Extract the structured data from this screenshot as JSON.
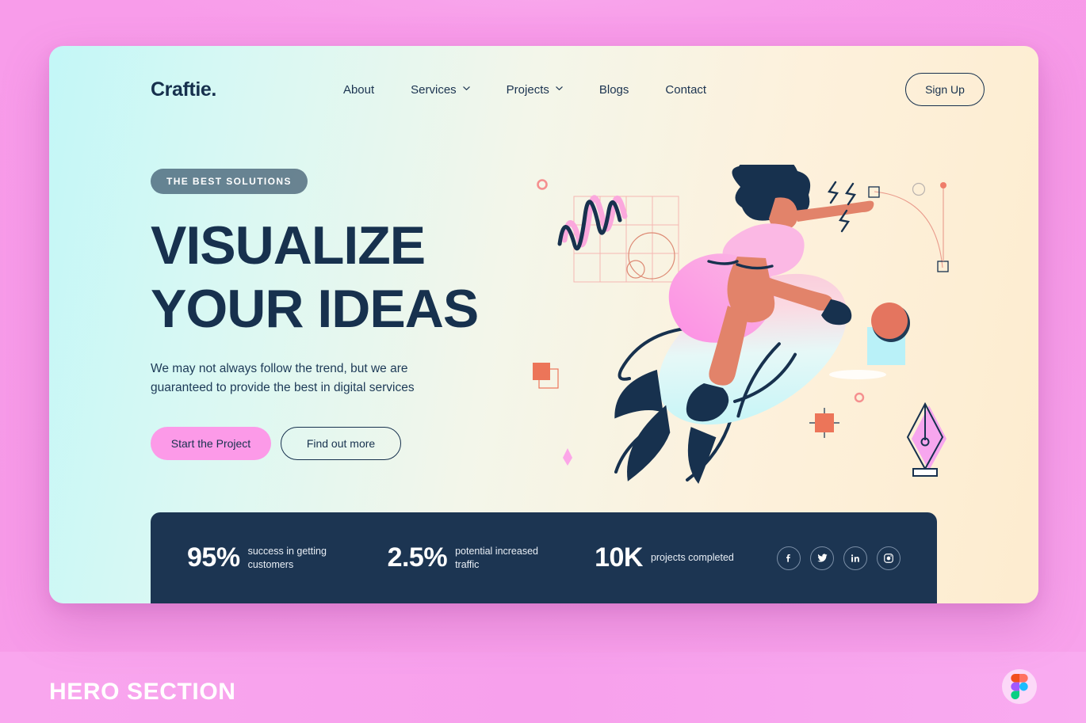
{
  "page": {
    "caption": "HERO SECTION",
    "figma_icon": "figma-logo-icon",
    "background_color": "#f79ae8"
  },
  "card": {
    "header": {
      "logo": "Craftie.",
      "nav": [
        {
          "label": "About",
          "has_dropdown": false
        },
        {
          "label": "Services",
          "has_dropdown": true
        },
        {
          "label": "Projects",
          "has_dropdown": true
        },
        {
          "label": "Blogs",
          "has_dropdown": false
        },
        {
          "label": "Contact",
          "has_dropdown": false
        }
      ],
      "signup_label": "Sign Up"
    },
    "hero": {
      "badge": "THE BEST SOLUTIONS",
      "headline_line1": "VISUALIZE",
      "headline_line2": "YOUR IDEAS",
      "subtext": "We may not always follow the trend, but we are guaranteed to provide the best in digital services",
      "primary_cta": "Start the Project",
      "secondary_cta": "Find out more",
      "illustration": "woman-riding-rocket-illustration"
    },
    "stats": {
      "items": [
        {
          "value": "95%",
          "label": "success in getting customers"
        },
        {
          "value": "2.5%",
          "label": "potential increased traffic"
        },
        {
          "value": "10K",
          "label": "projects completed"
        }
      ],
      "socials": [
        {
          "name": "facebook-icon"
        },
        {
          "name": "twitter-icon"
        },
        {
          "name": "linkedin-icon"
        },
        {
          "name": "instagram-icon"
        }
      ]
    },
    "colors": {
      "bg_left": "#c3f7f7",
      "bg_right": "#fdeccf",
      "navy": "#17314e",
      "pink": "#fc9ae8",
      "stats_bg": "#1c3552"
    }
  }
}
